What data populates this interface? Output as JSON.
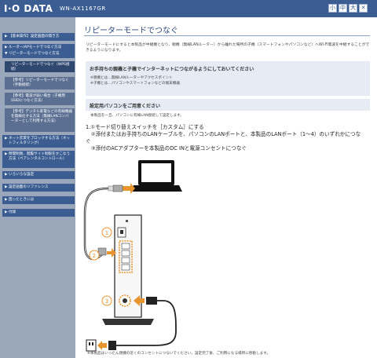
{
  "header": {
    "logo": "I·O DATA",
    "model": "WN-AX1167GR",
    "buttons": [
      "小",
      "中",
      "大",
      "✕"
    ]
  },
  "sidebar": {
    "items": [
      {
        "label": "【基本操作】設定画面の開き方",
        "level": 0
      },
      {
        "label": "ルーター/APモードでつなぐ方法",
        "level": 0
      },
      {
        "label": "リピーターモードでつなぐ方法",
        "level": 0
      },
      {
        "label": "リピーターモードでつなぐ（WPS接続）",
        "level": 1
      },
      {
        "label": "【参考】リピーターモードでつなぐ（手動接続）",
        "level": 1
      },
      {
        "label": "【参考】電波が弱い場合（子機用SSIDにつなぐ方法）",
        "level": 1
      },
      {
        "label": "【参考】デジタル家電などの有線機器を無線化する方法（無線LANコンバーターとして利用する方法）",
        "level": 1
      },
      {
        "label": "ネット詐欺をブロックする方法（ネットフィルタリング）",
        "level": 0
      },
      {
        "label": "時間制限、閲覧サイト制限をかこなう方法（ペアレンタルコントロール）",
        "level": 0
      },
      {
        "label": "いろいろな設定",
        "level": 0
      },
      {
        "label": "設定画面のリファレンス",
        "level": 0
      },
      {
        "label": "困ったときには",
        "level": 0
      },
      {
        "label": "付録",
        "level": 0
      }
    ]
  },
  "main": {
    "title": "リピーターモードでつなぐ",
    "intro": "リピーターモードにすると本製品が中継機となり、親機（無線LANルーター）から離れた場所の子機（スマートフォンやパソコンなど）へWi-Fi電波を中継することができるようになります。",
    "box1": {
      "heading": "お手持ちの親機と子機でインターネットにつながるようにしておいてください",
      "lines": [
        "※親機とは…無線LANルーターやアクセスポイント",
        "※子機とは…パソコンやスマートフォンなどの端末機器"
      ]
    },
    "box2": {
      "heading": "設定用パソコンをご用意ください",
      "line": "本製品を一旦、パソコンに有線LAN接続して設定します。"
    },
    "steps": [
      "1.①モード切り替えスイッチを［カスタム］にする",
      "　②添付またはお手持ちのLANケーブルを、パソコンのLANポートと、本製品のLANポート（1～4）のいずれかにつな",
      "ぐ",
      "　③添付のACアダプターを本製品のDC INと電源コンセントにつなぐ"
    ],
    "callouts": [
      "①",
      "②",
      "③"
    ],
    "footnote": "※本製品はいったん親機の近くのコンセントにつないでください。設定完了後、ご利用になる場所に移動します。"
  },
  "colors": {
    "header": "#3b5d92",
    "sidebar_bg": "#9aa7bb",
    "nav_item": "#3b5d92",
    "box_bg": "#e7ecf4",
    "accent_orange": "#e8952f"
  }
}
